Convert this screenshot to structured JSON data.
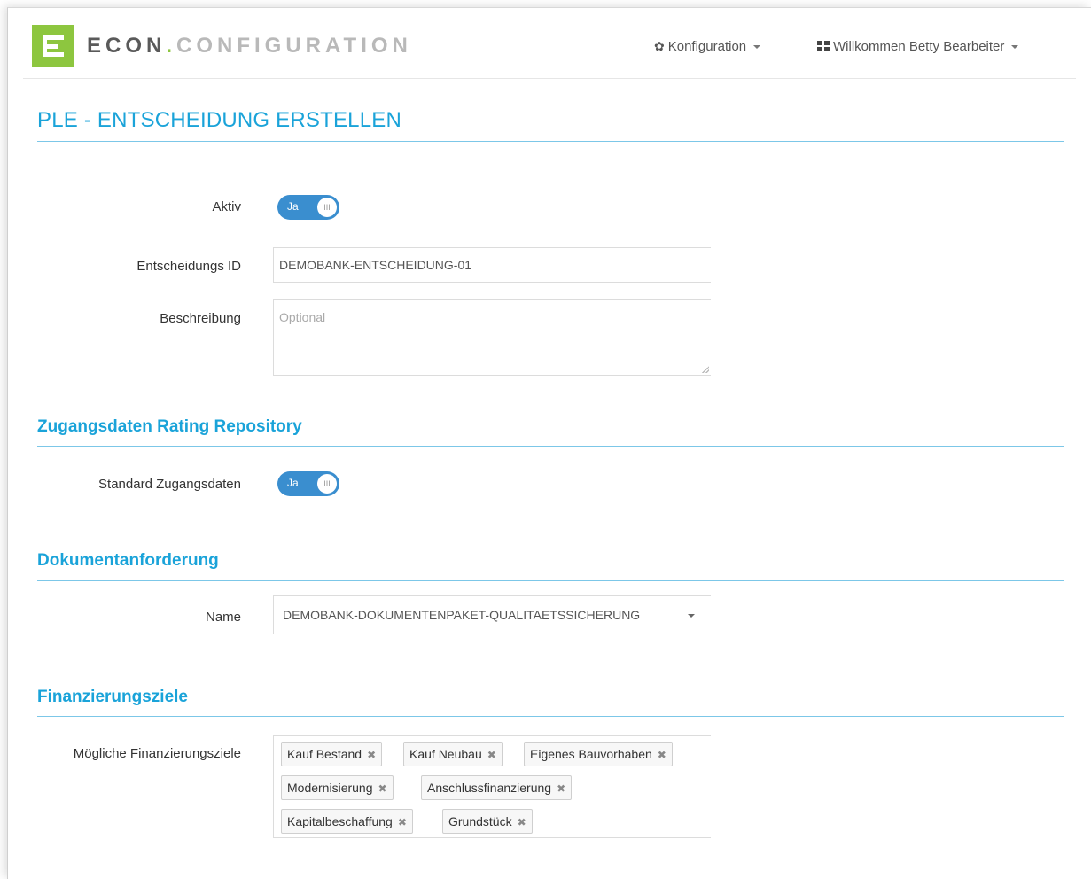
{
  "header": {
    "brand_part1": "ECON",
    "brand_dot": ".",
    "brand_part2": "CONFIGURATION",
    "config_menu": "Konfiguration",
    "user_menu": "Willkommen Betty Bearbeiter",
    "icons": {
      "config": "gear-icon",
      "user": "grid-icon",
      "logo": "econ-logo-icon"
    }
  },
  "page": {
    "title": "PLE - ENTSCHEIDUNG ERSTELLEN"
  },
  "form": {
    "aktiv_label": "Aktiv",
    "aktiv_toggle": "Ja",
    "entscheidungs_id_label": "Entscheidungs ID",
    "entscheidungs_id_value": "DEMOBANK-ENTSCHEIDUNG-01",
    "beschreibung_label": "Beschreibung",
    "beschreibung_placeholder": "Optional"
  },
  "section_rating": {
    "title": "Zugangsdaten Rating Repository",
    "standard_label": "Standard Zugangsdaten",
    "standard_toggle": "Ja"
  },
  "section_dokument": {
    "title": "Dokumentanforderung",
    "name_label": "Name",
    "name_value": "DEMOBANK-DOKUMENTENPAKET-QUALITAETSSICHERUNG"
  },
  "section_finanz": {
    "title": "Finanzierungsziele",
    "ziele_label": "Mögliche Finanzierungsziele",
    "tags": [
      "Kauf Bestand",
      "Kauf Neubau",
      "Eigenes Bauvorhaben",
      "Modernisierung",
      "Anschlussfinanzierung",
      "Kapitalbeschaffung",
      "Grundstück"
    ]
  },
  "colors": {
    "accent": "#1aa3d9",
    "brand_green": "#8dc63f",
    "toggle": "#3a8ecf"
  }
}
